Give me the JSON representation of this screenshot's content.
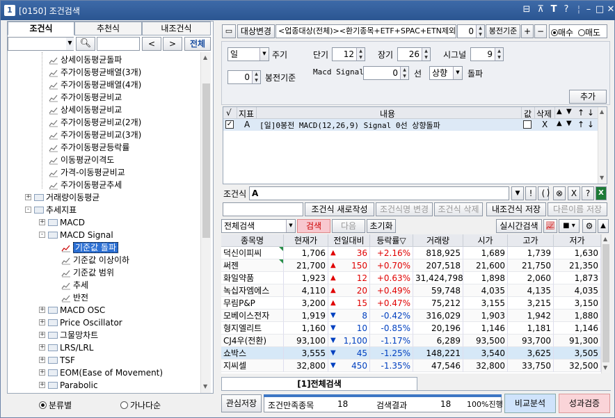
{
  "window": {
    "number": "1",
    "title": "[0150] 조건검색"
  },
  "left_tabs": [
    "조건식",
    "추천식",
    "내조건식"
  ],
  "search": {
    "prev": "<",
    "next": ">",
    "all": "전체"
  },
  "tree": [
    {
      "type": "leaf",
      "label": "상세이동평균돌파"
    },
    {
      "type": "leaf",
      "label": "주가이동평균배열(3개)"
    },
    {
      "type": "leaf",
      "label": "주가이동평균배열(4개)"
    },
    {
      "type": "leaf",
      "label": "주가이동평균비교"
    },
    {
      "type": "leaf",
      "label": "상세이동평균비교"
    },
    {
      "type": "leaf",
      "label": "주가이동평균비교(2개)"
    },
    {
      "type": "leaf",
      "label": "주가이동평균비교(3개)"
    },
    {
      "type": "leaf",
      "label": "주가이동평균등락률"
    },
    {
      "type": "leaf",
      "label": "이동평균이격도"
    },
    {
      "type": "leaf",
      "label": "가격-이동평균비교"
    },
    {
      "type": "leaf",
      "label": "주가이동평균추세"
    },
    {
      "type": "folder",
      "label": "거래량이동평균",
      "pm": "+"
    },
    {
      "type": "folder",
      "label": "추세지표",
      "pm": "-"
    },
    {
      "type": "folder",
      "label": "MACD",
      "pm": "+"
    },
    {
      "type": "folder",
      "label": "MACD Signal",
      "pm": "-"
    },
    {
      "type": "leaf",
      "label": "기준값 돌파",
      "selected": true
    },
    {
      "type": "leaf",
      "label": "기준값 이상이하"
    },
    {
      "type": "leaf",
      "label": "기준값 범위"
    },
    {
      "type": "leaf",
      "label": "추세"
    },
    {
      "type": "leaf",
      "label": "반전"
    },
    {
      "type": "folder",
      "label": "MACD OSC",
      "pm": "+"
    },
    {
      "type": "folder",
      "label": "Price Oscillator",
      "pm": "+"
    },
    {
      "type": "folder",
      "label": "그물망차트",
      "pm": "+"
    },
    {
      "type": "folder",
      "label": "LRS/LRL",
      "pm": "+"
    },
    {
      "type": "folder",
      "label": "TSF",
      "pm": "+"
    },
    {
      "type": "folder",
      "label": "EOM(Ease of Movement)",
      "pm": "+"
    },
    {
      "type": "folder",
      "label": "Parabolic",
      "pm": "+"
    }
  ],
  "bottom_radio": {
    "opt1": "분류별",
    "opt2": "가나다순"
  },
  "toolbar": {
    "change_target": "대상변경",
    "target_text": "<업종대상(전체)><환기종목+ETF+SPAC+ETN제외>",
    "bong_value": "0",
    "bong_label": "봉전기준",
    "plus": "+",
    "minus": "−",
    "buy": "매수",
    "sell": "매도"
  },
  "params": {
    "period": "일",
    "period_label": "주기",
    "bong_value": "0",
    "bong_label": "봉전기준",
    "short_label": "단기",
    "short_value": "12",
    "long_label": "장기",
    "long_value": "26",
    "signal_label": "시그널",
    "signal_value": "9",
    "macd_label": "Macd Signal",
    "macd_value": "0",
    "line_label": "선",
    "direction": "상향",
    "breakout_label": "돌파",
    "add_btn": "추가"
  },
  "cond_table": {
    "headers": [
      "√",
      "지표",
      "내용",
      "값",
      "삭제",
      "▲",
      "▼",
      "↑",
      "↓"
    ],
    "row": {
      "indicator": "A",
      "content": "[일]0봉전 MACD(12,26,9) Signal 0선 상향돌파",
      "delete": "X",
      "up": "▲",
      "down": "▼",
      "top": "↑",
      "bottom": "↓"
    }
  },
  "cond_expr": {
    "label": "조건식",
    "value": "A",
    "ops": [
      "▼",
      "!",
      "(",
      ")",
      "⊗",
      "X",
      "?"
    ]
  },
  "cond_buttons": {
    "new": "조건식 새로작성",
    "rename": "조건식명 변경",
    "delete": "조건식 삭제",
    "save_mine": "내조건식 저장",
    "save_as": "다른이름 저장"
  },
  "search_bar": {
    "scope": "전체검색",
    "search": "검색",
    "next": "다음",
    "reset": "초기화",
    "realtime": "실시간검색"
  },
  "results": {
    "headers": [
      "종목명",
      "현재가",
      "전일대비",
      "등락률▽",
      "거래량",
      "시가",
      "고가",
      "저가"
    ],
    "rows": [
      {
        "name": "덕신이피씨",
        "price": "1,706",
        "dir": "up",
        "change": "36",
        "rate": "+2.16%",
        "volume": "818,925",
        "open": "1,689",
        "high": "1,739",
        "low": "1,630"
      },
      {
        "name": "써젠",
        "price": "21,700",
        "dir": "up",
        "change": "150",
        "rate": "+0.70%",
        "volume": "207,518",
        "open": "21,600",
        "high": "21,750",
        "low": "21,350"
      },
      {
        "name": "화일약품",
        "price": "1,923",
        "dir": "up",
        "change": "12",
        "rate": "+0.63%",
        "volume": "31,424,798",
        "open": "1,898",
        "high": "2,060",
        "low": "1,873"
      },
      {
        "name": "녹십자엠에스",
        "price": "4,110",
        "dir": "up",
        "change": "20",
        "rate": "+0.49%",
        "volume": "59,748",
        "open": "4,035",
        "high": "4,135",
        "low": "4,035"
      },
      {
        "name": "무림P&P",
        "price": "3,200",
        "dir": "up",
        "change": "15",
        "rate": "+0.47%",
        "volume": "75,212",
        "open": "3,155",
        "high": "3,215",
        "low": "3,150"
      },
      {
        "name": "모베이스전자",
        "price": "1,919",
        "dir": "dn",
        "change": "8",
        "rate": "-0.42%",
        "volume": "316,029",
        "open": "1,903",
        "high": "1,942",
        "low": "1,880"
      },
      {
        "name": "형지엘리트",
        "price": "1,160",
        "dir": "dn",
        "change": "10",
        "rate": "-0.85%",
        "volume": "20,196",
        "open": "1,146",
        "high": "1,181",
        "low": "1,146"
      },
      {
        "name": "CJ4우(전환)",
        "price": "93,100",
        "dir": "dn",
        "change": "1,100",
        "rate": "-1.17%",
        "volume": "6,289",
        "open": "93,500",
        "high": "93,700",
        "low": "91,300"
      },
      {
        "name": "쇼박스",
        "price": "3,555",
        "dir": "dn",
        "change": "45",
        "rate": "-1.25%",
        "volume": "148,221",
        "open": "3,540",
        "high": "3,625",
        "low": "3,505",
        "selected": true
      },
      {
        "name": "지씨셀",
        "price": "32,800",
        "dir": "dn",
        "change": "450",
        "rate": "-1.35%",
        "volume": "47,546",
        "open": "32,800",
        "high": "33,750",
        "low": "32,500"
      }
    ]
  },
  "bottom_tab": "[1]전체검색",
  "status": {
    "save_interest": "관심저장",
    "matched_label": "조건만족종목",
    "matched_value": "18",
    "result_label": "검색결과",
    "result_value": "18",
    "progress_text": "100%진행",
    "progress": 1.0,
    "compare": "비교분석",
    "verify": "성과검증"
  }
}
